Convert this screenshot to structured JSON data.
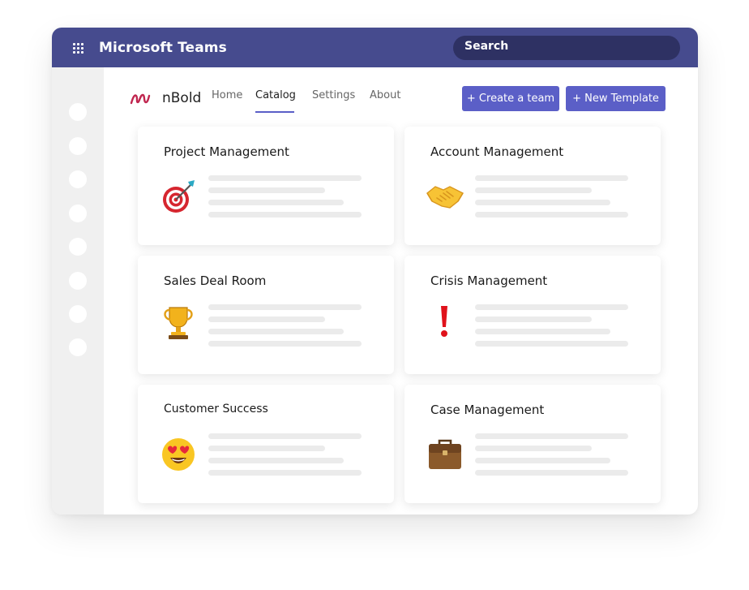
{
  "app": {
    "title": "Microsoft Teams",
    "search_label": "Search"
  },
  "brand": {
    "name": "nBold"
  },
  "nav": [
    {
      "label": "Home"
    },
    {
      "label": "Catalog",
      "active": true
    },
    {
      "label": "Settings"
    },
    {
      "label": "About"
    }
  ],
  "actions": {
    "create_team": "+ Create a team",
    "new_template": "+ New Template"
  },
  "cards": [
    {
      "title": "Project Management",
      "icon": "target-dart-icon"
    },
    {
      "title": "Account Management",
      "icon": "handshake-icon"
    },
    {
      "title": "Sales Deal Room",
      "icon": "trophy-icon"
    },
    {
      "title": "Crisis Management",
      "icon": "exclamation-icon"
    },
    {
      "title": "Customer Success",
      "icon": "heart-eyes-emoji-icon"
    },
    {
      "title": "Case Management",
      "icon": "briefcase-icon"
    }
  ],
  "colors": {
    "titlebar": "#464b8e",
    "search": "#2e3163",
    "accent": "#5b5fc7",
    "logo": "#c0264f"
  }
}
